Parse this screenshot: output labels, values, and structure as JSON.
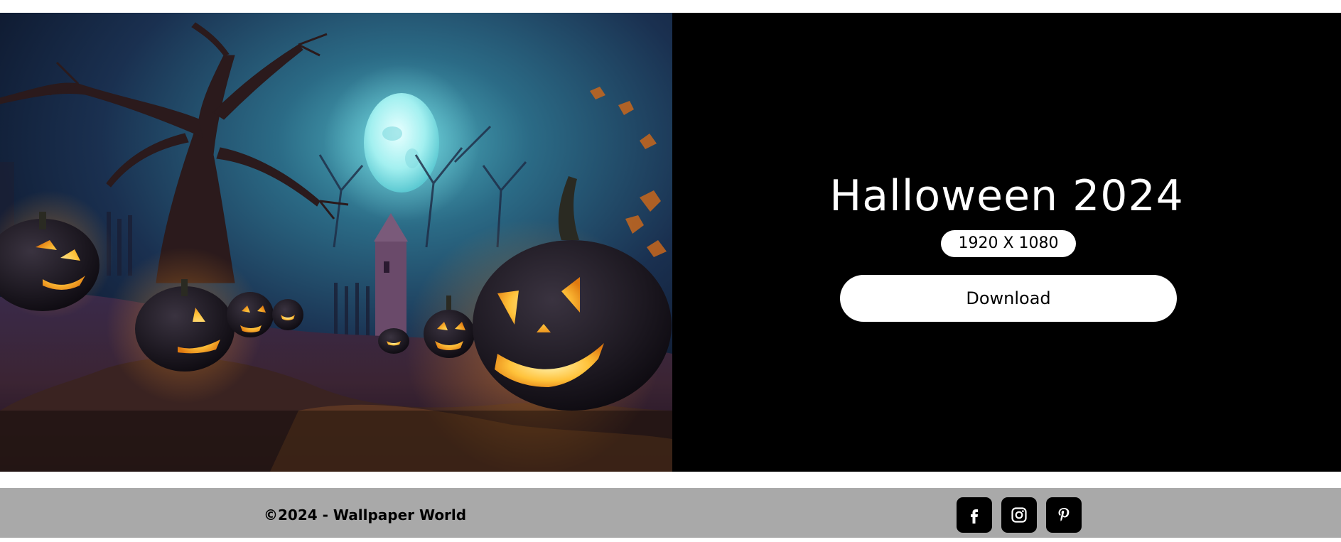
{
  "hero": {
    "title": "Halloween 2024",
    "resolution": "1920 X 1080",
    "download_label": "Download",
    "image_icon": "halloween-pumpkin-night-scene"
  },
  "footer": {
    "copyright": "©2024 - Wallpaper World",
    "social": [
      {
        "icon": "facebook-icon"
      },
      {
        "icon": "instagram-icon"
      },
      {
        "icon": "pinterest-icon"
      }
    ]
  },
  "colors": {
    "page_background": "#ffffff",
    "hero_background": "#000000",
    "footer_background": "#a9a9a9",
    "button_background": "#ffffff",
    "social_button_background": "#000000"
  }
}
